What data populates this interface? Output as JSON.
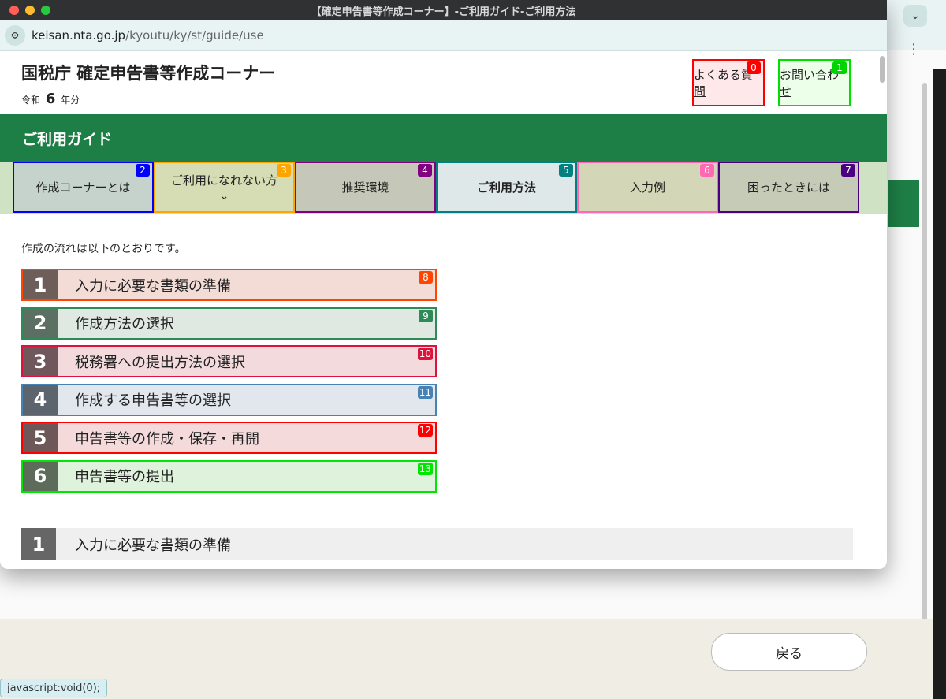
{
  "window": {
    "title": "【確定申告書等作成コーナー】-ご利用ガイド-ご利用方法",
    "url_host": "keisan.nta.go.jp",
    "url_path": "/kyoutu/ky/st/guide/use"
  },
  "header": {
    "site_title": "国税庁 確定申告書等作成コーナー",
    "year_prefix": "令和",
    "year_num": "6",
    "year_suffix": "年分",
    "links": [
      {
        "label": "よくある質問",
        "badge": "0",
        "color": "#ff0000"
      },
      {
        "label": "お問い合わせ",
        "badge": "1",
        "color": "#00d400"
      }
    ]
  },
  "guide_bar": {
    "title": "ご利用ガイド"
  },
  "tabs": [
    {
      "label": "作成コーナーとは",
      "badge": "2",
      "color": "#0000ff"
    },
    {
      "label": "ご利用になれない方",
      "badge": "3",
      "color": "#ffa500",
      "has_dropdown": true
    },
    {
      "label": "推奨環境",
      "badge": "4",
      "color": "#800080"
    },
    {
      "label": "ご利用方法",
      "badge": "5",
      "color": "#008080",
      "active": true
    },
    {
      "label": "入力例",
      "badge": "6",
      "color": "#ff69b4"
    },
    {
      "label": "困ったときには",
      "badge": "7",
      "color": "#4b0082"
    }
  ],
  "intro_text": "作成の流れは以下のとおりです。",
  "steps": [
    {
      "num": "1",
      "label": "入力に必要な書類の準備",
      "badge": "8",
      "color": "#ff4500",
      "bg": "#f4dcd6",
      "num_bg": "#6e5e5a"
    },
    {
      "num": "2",
      "label": "作成方法の選択",
      "badge": "9",
      "color": "#2e8b57",
      "bg": "#dfe9e2",
      "num_bg": "#5b6f62"
    },
    {
      "num": "3",
      "label": "税務署への提出方法の選択",
      "badge": "10",
      "color": "#dc143c",
      "bg": "#f3dadd",
      "num_bg": "#6f575b"
    },
    {
      "num": "4",
      "label": "作成する申告書等の選択",
      "badge": "11",
      "color": "#4682b4",
      "bg": "#e2e7ee",
      "num_bg": "#5c646d"
    },
    {
      "num": "5",
      "label": "申告書等の作成・保存・再開",
      "badge": "12",
      "color": "#ff0000",
      "bg": "#f4dadb",
      "num_bg": "#6e5758"
    },
    {
      "num": "6",
      "label": "申告書等の提出",
      "badge": "13",
      "color": "#00e600",
      "bg": "#dff2dc",
      "num_bg": "#5c6b5a"
    }
  ],
  "section": {
    "num": "1",
    "label": "入力に必要な書類の準備"
  },
  "background_page": {
    "back_button": "戻る",
    "status_text": "javascript:void(0);"
  },
  "icons": {
    "site_settings": "site-settings-icon",
    "dropdown": "chevron-down-icon",
    "more": "more-vert-icon",
    "expand": "chevron-down-icon"
  }
}
